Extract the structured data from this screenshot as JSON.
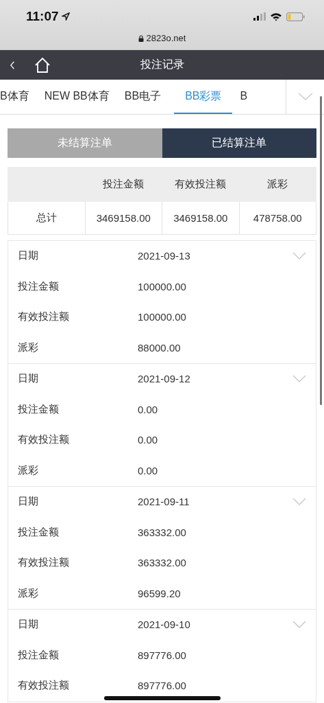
{
  "status_bar": {
    "time": "11:07",
    "url": "2823o.net"
  },
  "nav": {
    "title": "投注记录"
  },
  "tabs": [
    {
      "label": "B体育",
      "selected": false
    },
    {
      "label": "NEW BB体育",
      "selected": false
    },
    {
      "label": "BB电子",
      "selected": false
    },
    {
      "label": "BB彩票",
      "selected": true
    },
    {
      "label": "B",
      "selected": false
    }
  ],
  "segments": [
    {
      "label": "未结算注单",
      "selected": false
    },
    {
      "label": "已结算注单",
      "selected": true
    }
  ],
  "summary": {
    "columns": [
      "投注金额",
      "有效投注额",
      "派彩"
    ],
    "total_label": "总计",
    "totals": [
      "3469158.00",
      "3469158.00",
      "478758.00"
    ]
  },
  "records": [
    {
      "fields": [
        {
          "label": "日期",
          "value": "2021-09-13"
        },
        {
          "label": "投注金额",
          "value": "100000.00"
        },
        {
          "label": "有效投注额",
          "value": "100000.00"
        },
        {
          "label": "派彩",
          "value": "88000.00"
        }
      ]
    },
    {
      "fields": [
        {
          "label": "日期",
          "value": "2021-09-12"
        },
        {
          "label": "投注金额",
          "value": "0.00"
        },
        {
          "label": "有效投注额",
          "value": "0.00"
        },
        {
          "label": "派彩",
          "value": "0.00"
        }
      ]
    },
    {
      "fields": [
        {
          "label": "日期",
          "value": "2021-09-11"
        },
        {
          "label": "投注金额",
          "value": "363332.00"
        },
        {
          "label": "有效投注额",
          "value": "363332.00"
        },
        {
          "label": "派彩",
          "value": "96599.20"
        }
      ]
    },
    {
      "fields": [
        {
          "label": "日期",
          "value": "2021-09-10"
        },
        {
          "label": "投注金额",
          "value": "897776.00"
        },
        {
          "label": "有效投注额",
          "value": "897776.00"
        }
      ]
    }
  ]
}
